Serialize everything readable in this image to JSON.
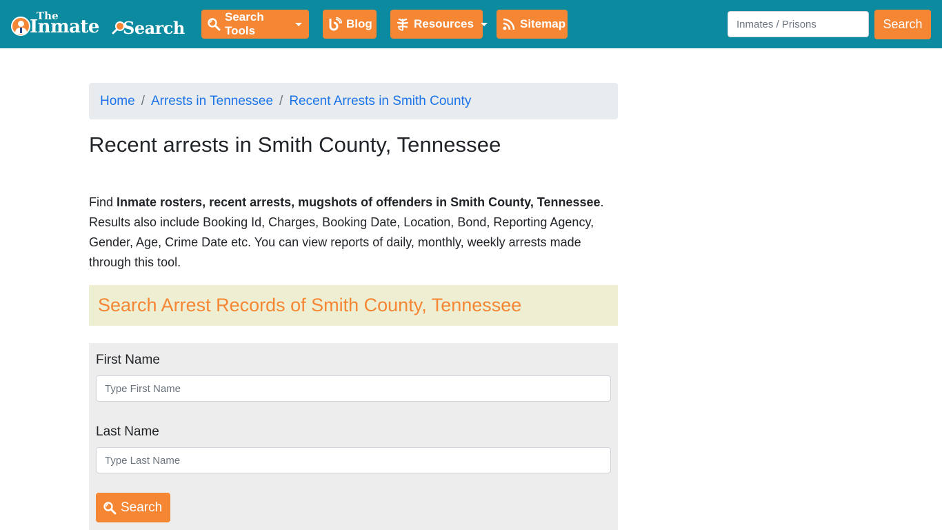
{
  "brand": {
    "logo_the": "The",
    "logo_inmate": "Inmate",
    "logo_search": "Search",
    "colors": {
      "navbar": "#0b8aa0",
      "accent": "#f58634",
      "link": "#1a73e8",
      "heading_bg": "#eeeed2",
      "form_bg": "#ededed"
    }
  },
  "nav": {
    "items": [
      {
        "label": "Search Tools",
        "icon": "search-icon",
        "dropdown": true
      },
      {
        "label": "Blog",
        "icon": "blogger-icon",
        "dropdown": false
      },
      {
        "label": "Resources",
        "icon": "leaf-icon",
        "dropdown": true
      },
      {
        "label": "Sitemap",
        "icon": "rss-icon",
        "dropdown": false
      }
    ],
    "search": {
      "placeholder": "Inmates / Prisons",
      "value": "",
      "button_label": "Search"
    }
  },
  "breadcrumb": [
    {
      "label": "Home"
    },
    {
      "label": "Arrests in Tennessee"
    },
    {
      "label": "Recent Arrests in Smith County"
    }
  ],
  "main": {
    "title": "Recent arrests in Smith County, Tennessee",
    "intro": {
      "prefix": "Find ",
      "bold": "Inmate rosters, recent arrests, mugshots of offenders in Smith County, Tennessee",
      "suffix": ". Results also include Booking Id, Charges, Booking Date, Location, Bond, Reporting Agency, Gender, Age, Crime Date etc. You can view reports of daily, monthly, weekly arrests made through this tool."
    },
    "search_heading": "Search Arrest Records of Smith County, Tennessee",
    "form": {
      "first_name_label": "First Name",
      "first_name_placeholder": "Type First Name",
      "first_name_value": "",
      "last_name_label": "Last Name",
      "last_name_placeholder": "Type Last Name",
      "last_name_value": "",
      "submit_label": "Search"
    }
  }
}
